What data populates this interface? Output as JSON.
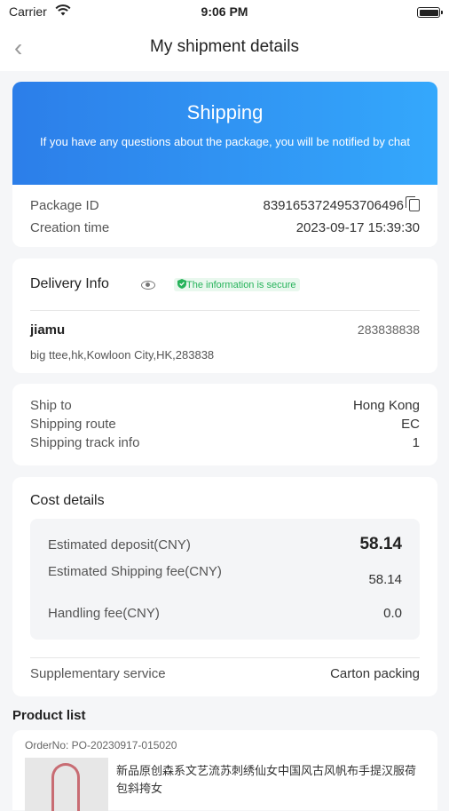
{
  "status_bar": {
    "carrier": "Carrier",
    "time": "9:06 PM"
  },
  "nav": {
    "title": "My shipment details",
    "back_icon": "chevron-left-icon"
  },
  "hero": {
    "title": "Shipping",
    "subtitle": "If you have any questions about the package, you will be notified by chat",
    "gradient": [
      "#2c7ee9",
      "#34a8fc"
    ]
  },
  "package": {
    "id_label": "Package ID",
    "id_value": "8391653724953706496",
    "created_label": "Creation time",
    "created_value": "2023-09-17 15:39:30"
  },
  "delivery": {
    "title": "Delivery Info",
    "secure_text": "The information is secure",
    "name": "jiamu",
    "phone": "283838838",
    "address": "big ttee,hk,Kowloon City,HK,283838"
  },
  "route": {
    "ship_to_label": "Ship to",
    "ship_to_value": "Hong Kong",
    "shipping_route_label": "Shipping route",
    "shipping_route_value": "EC",
    "track_label": "Shipping track info",
    "track_value": "1"
  },
  "cost": {
    "title": "Cost details",
    "deposit_label": "Estimated deposit(CNY)",
    "deposit_value": "58.14",
    "shipping_fee_label": "Estimated Shipping fee(CNY)",
    "shipping_fee_value": "58.14",
    "handling_label": "Handling fee(CNY)",
    "handling_value": "0.0",
    "supplementary_label": "Supplementary service",
    "supplementary_value": "Carton packing"
  },
  "products": {
    "title": "Product list",
    "items": [
      {
        "order_no": "OrderNo: PO-20230917-015020",
        "name": "新品原创森系文艺流苏刺绣仙女中国风古风帆布手提汉服荷包斜挎女"
      }
    ]
  },
  "colors": {
    "accent": "#2c7ee9",
    "secure_green": "#27b35b"
  }
}
